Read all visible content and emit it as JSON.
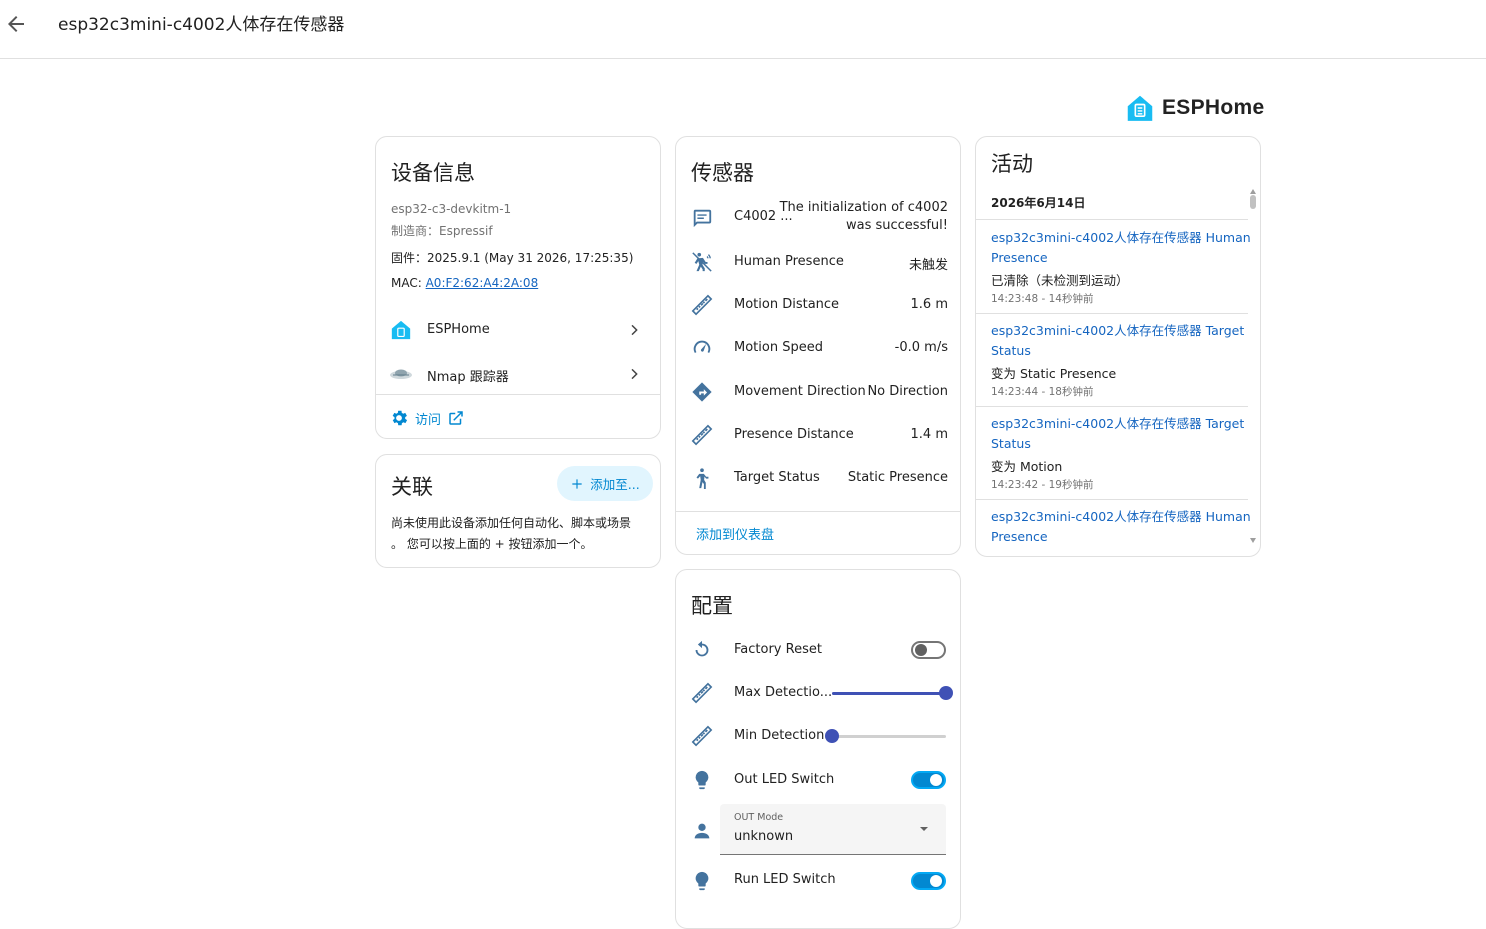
{
  "header": {
    "title": "esp32c3mini-c4002人体存在传感器"
  },
  "brand": {
    "name": "ESPHome",
    "color": "#18bcf2"
  },
  "device_info": {
    "title": "设备信息",
    "model": "esp32-c3-devkitm-1",
    "manufacturer": "制造商：Espressif",
    "firmware": "固件：2025.9.1 (May 31 2026, 17:25:35)",
    "mac_label": "MAC: ",
    "mac": "A0:F2:62:A4:2A:08",
    "integrations": [
      {
        "label": "ESPHome",
        "icon": "esphome-icon"
      },
      {
        "label": "Nmap 跟踪器",
        "icon": "nmap-icon"
      }
    ],
    "visit_label": "访问"
  },
  "related": {
    "title": "关联",
    "add_label": "添加至...",
    "empty_text_line1": "尚未使用此设备添加任何自动化、脚本或场景",
    "empty_text_line2": "。 您可以按上面的 + 按钮添加一个。"
  },
  "sensors": {
    "title": "传感器",
    "rows": [
      {
        "label": "C4002 ...",
        "value_line1": "The initialization of c4002",
        "value_line2": "was successful!",
        "icon": "message-icon"
      },
      {
        "label": "Human Presence",
        "value": "未触发",
        "icon": "motion-sensor-off-icon"
      },
      {
        "label": "Motion Distance",
        "value": "1.6 m",
        "icon": "ruler-icon"
      },
      {
        "label": "Motion Speed",
        "value": "-0.0 m/s",
        "icon": "speedometer-icon"
      },
      {
        "label": "Movement Direction",
        "value": "No Direction",
        "icon": "direction-icon"
      },
      {
        "label": "Presence Distance",
        "value": "1.4 m",
        "icon": "ruler-icon"
      },
      {
        "label": "Target Status",
        "value": "Static Presence",
        "icon": "human-icon"
      }
    ],
    "add_dashboard": "添加到仪表盘"
  },
  "config": {
    "title": "配置",
    "factory_reset": {
      "label": "Factory Reset",
      "state": "off"
    },
    "max_detection": {
      "label": "Max Detectio...",
      "level": 1.0
    },
    "min_detection": {
      "label": "Min Detection...",
      "level": 0.0
    },
    "out_led": {
      "label": "Out LED Switch",
      "state": "on"
    },
    "out_mode": {
      "label": "OUT Mode",
      "value": "unknown"
    },
    "run_led": {
      "label": "Run LED Switch",
      "state": "on"
    }
  },
  "activity": {
    "title": "活动",
    "date": "2026年6月14日",
    "entries": [
      {
        "name_line1": "esp32c3mini-c4002人体存在传感器 Human",
        "name_line2": "Presence",
        "message": "已清除（未检测到运动）",
        "time": "14:23:48 - 14秒钟前"
      },
      {
        "name_line1": "esp32c3mini-c4002人体存在传感器 Target",
        "name_line2": "Status",
        "message": "变为 Static Presence",
        "time": "14:23:44 - 18秒钟前"
      },
      {
        "name_line1": "esp32c3mini-c4002人体存在传感器 Target",
        "name_line2": "Status",
        "message": "变为 Motion",
        "time": "14:23:42 - 19秒钟前"
      },
      {
        "name_line1": "esp32c3mini-c4002人体存在传感器 Human",
        "name_line2": "Presence",
        "message": "",
        "time": ""
      }
    ]
  },
  "colors": {
    "primary": "#03a9f4",
    "slider": "#3f51b5",
    "link": "#1565c0",
    "icon": "#44739e"
  }
}
